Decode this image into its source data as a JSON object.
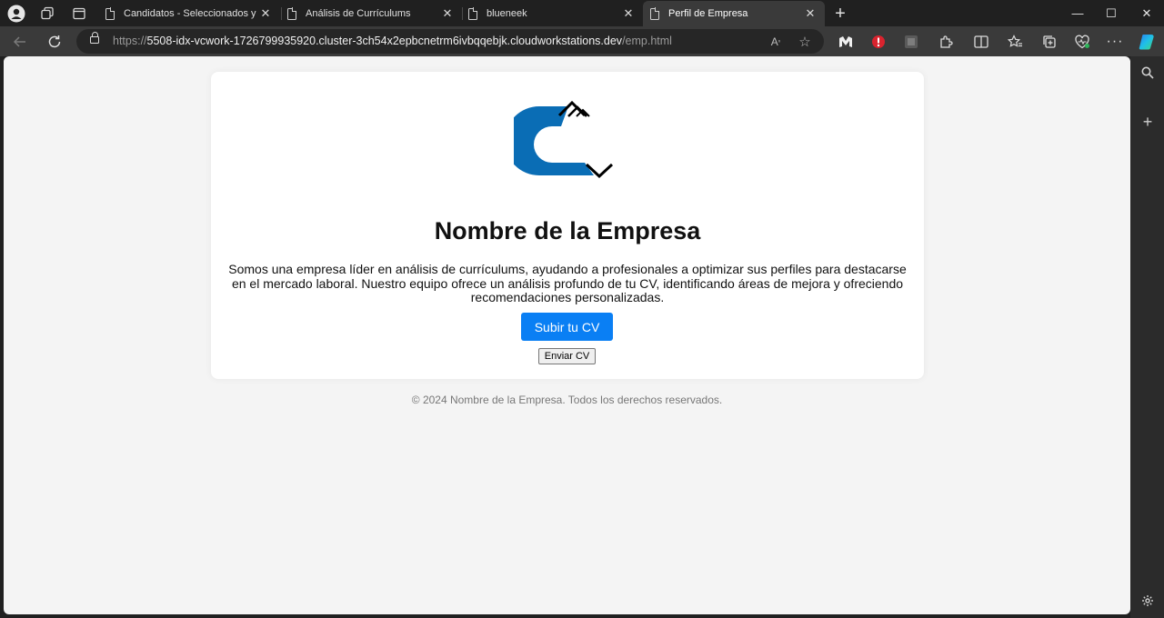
{
  "browser": {
    "tabs": [
      {
        "title": "Candidatos - Seleccionados y Rechazados",
        "active": false
      },
      {
        "title": "Análisis de Currículums",
        "active": false
      },
      {
        "title": "blueneek",
        "active": false
      },
      {
        "title": "Perfil de Empresa",
        "active": true
      }
    ],
    "new_tab_symbol": "+",
    "window_controls": {
      "minimize": "—",
      "maximize": "☐",
      "close": "✕"
    },
    "address": {
      "scheme": "https://",
      "host": "5508-idx-vcwork-1726799935920.cluster-3ch54x2epbcnetrm6ivbqqebjk.cloudworkstations.dev",
      "path": "/emp.html"
    },
    "icons": [
      "profile-icon",
      "workspaces-icon",
      "tab-actions-icon",
      "back-icon",
      "refresh-icon",
      "lock-icon",
      "read-aloud-icon",
      "favorite-star-icon",
      "extension-m-icon",
      "extension-shield-icon",
      "extension-grey-icon",
      "extensions-puzzle-icon",
      "split-screen-icon",
      "favorites-icon",
      "collections-icon",
      "browser-essentials-icon",
      "more-menu-icon",
      "copilot-icon",
      "sidebar-search-icon",
      "sidebar-add-icon",
      "sidebar-settings-icon"
    ]
  },
  "page": {
    "logo_name": "company-logo",
    "title": "Nombre de la Empresa",
    "description": "Somos una empresa líder en análisis de currículums, ayudando a profesionales a optimizar sus perfiles para destacarse en el mercado laboral. Nuestro equipo ofrece un análisis profundo de tu CV, identificando áreas de mejora y ofreciendo recomendaciones personalizadas.",
    "upload_button": "Subir tu CV",
    "send_button": "Enviar CV",
    "footer": "© 2024 Nombre de la Empresa. Todos los derechos reservados."
  },
  "colors": {
    "brand_blue": "#0a6db5",
    "button_blue": "#0a7ff4",
    "page_background": "#f4f4f4",
    "browser_chrome": "#202020"
  }
}
